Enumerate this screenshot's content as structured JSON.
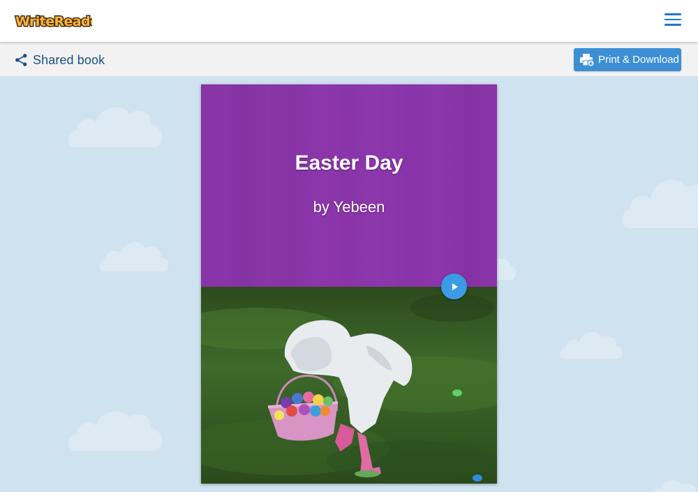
{
  "app": {
    "logo_text": "WriteReader",
    "menu_icon": "hamburger-icon"
  },
  "subbar": {
    "shared_label": "Shared book",
    "share_icon": "share-icon",
    "print_label": "Print & Download",
    "print_icon": "printer-download-icon"
  },
  "book": {
    "title": "Easter Day",
    "author": "by Yebeen",
    "play_icon": "play-icon"
  },
  "colors": {
    "accent_blue": "#3c8fd4",
    "cover_purple": "#8a33a8",
    "sky_background": "#cfe2ef",
    "nav_text": "#1b4f86"
  }
}
